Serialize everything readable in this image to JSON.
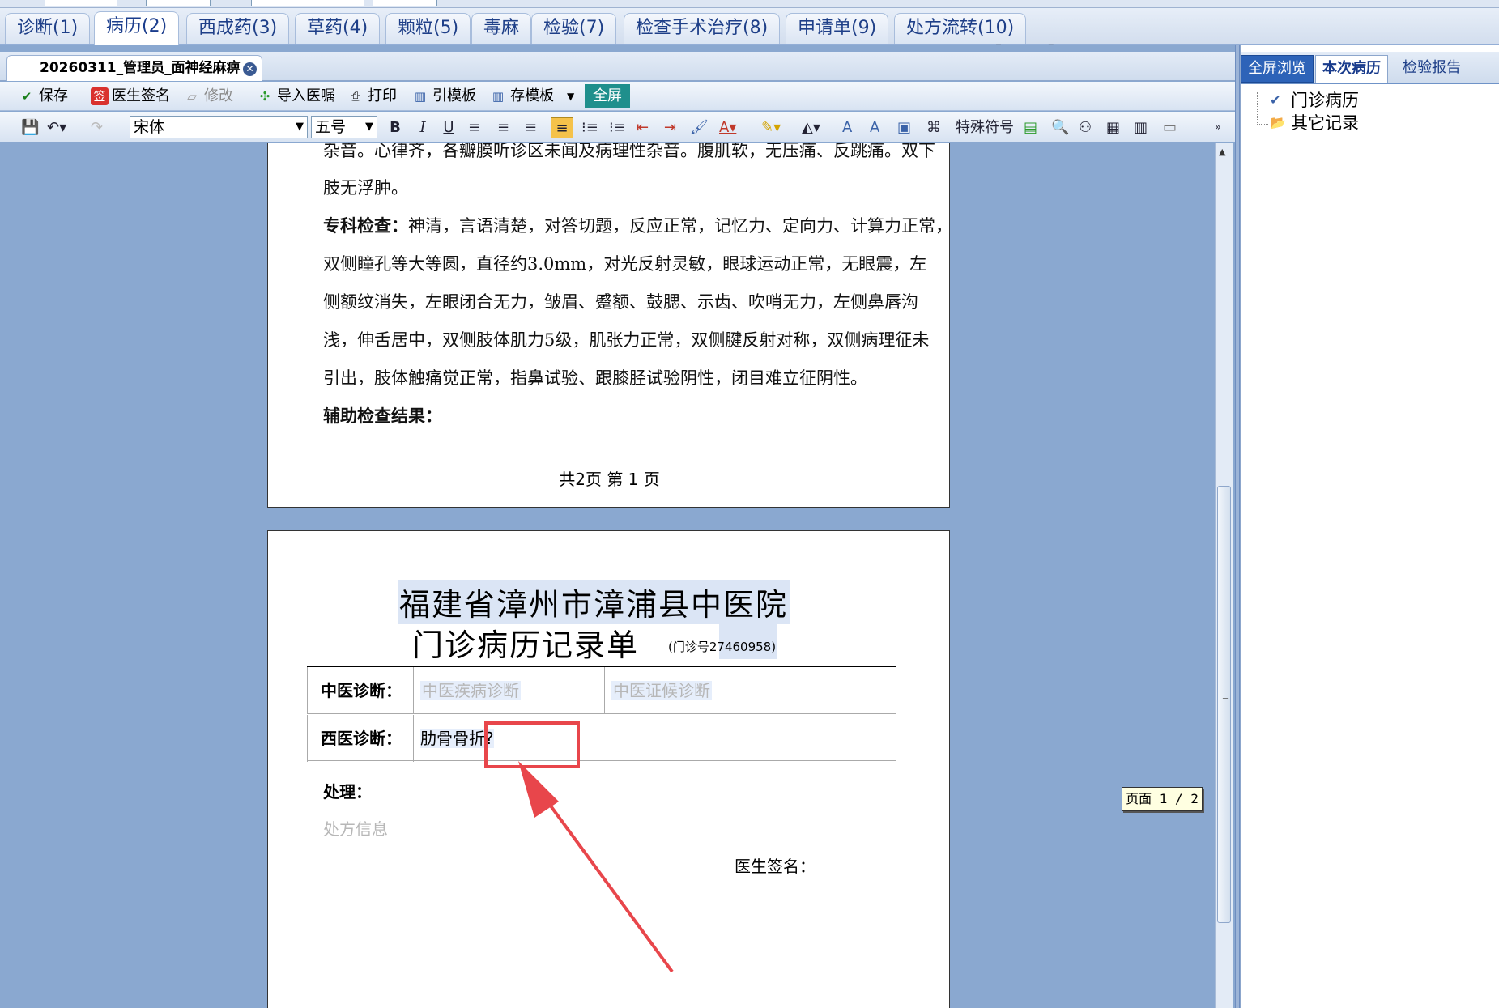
{
  "main_tabs": [
    {
      "label": "诊断(1)"
    },
    {
      "label": "病历(2)"
    },
    {
      "label": "西成药(3)"
    },
    {
      "label": "草药(4)"
    },
    {
      "label": "颗粒(5)"
    },
    {
      "label": "毒麻"
    },
    {
      "label": "检验(7)"
    },
    {
      "label": "检查手术治疗(8)"
    },
    {
      "label": "申请单(9)"
    },
    {
      "label": "处方流转(10)"
    }
  ],
  "document_tab": {
    "title": "20260311_管理员_面神经麻痹"
  },
  "toolbar1": {
    "save": "保存",
    "doctor_sign": "医生签名",
    "modify": "修改",
    "import_orders": "导入医嘱",
    "print": "打印",
    "use_template": "引模板",
    "save_template": "存模板",
    "fullscreen": "全屏"
  },
  "toolbar2": {
    "font_family": "宋体",
    "font_size": "五号",
    "bold": "B",
    "italic": "I",
    "underline": "U",
    "special_chars": "特殊符号"
  },
  "page1": {
    "line0": "杂音。心律齐，各瓣膜听诊区未闻及病理性杂音。腹肌软，无压痛、反跳痛。双下",
    "line1": "肢无浮肿。",
    "specialty_label": "专科检查：",
    "specialty_line1": "神清，言语清楚，对答切题，反应正常，记忆力、定向力、计算力正常，",
    "specialty_line2": "双侧瞳孔等大等圆，直径约3.0mm，对光反射灵敏，眼球运动正常，无眼震，左",
    "specialty_line3": "侧额纹消失，左眼闭合无力，皱眉、蹙额、鼓腮、示齿、吹哨无力，左侧鼻唇沟",
    "specialty_line4": "浅，伸舌居中，双侧肢体肌力5级，肌张力正常，双侧腱反射对称，双侧病理征未",
    "specialty_line5": "引出，肢体触痛觉正常，指鼻试验、跟膝胫试验阴性，闭目难立征阴性。",
    "aux_label": "辅助检查结果：",
    "footer": "共2页   第 1 页"
  },
  "page2": {
    "hospital_name": "福建省漳州市漳浦县中医院",
    "record_title": "门诊病历记录单",
    "visit_no": "(门诊号27460958)",
    "tcm_diag_label": "中医诊断：",
    "tcm_disease_placeholder": "中医疾病诊断",
    "tcm_syndrome_placeholder": "中医证候诊断",
    "western_diag_label": "西医诊断：",
    "western_diag_value": "肋骨骨折",
    "western_diag_mark": "?",
    "treatment_label": "处理：",
    "rx_placeholder": "处方信息",
    "doctor_sign_label": "医生签名："
  },
  "page_indicator": "页面 1 / 2",
  "right_panel": {
    "tabs": [
      {
        "label": "全屏浏览"
      },
      {
        "label": "本次病历"
      },
      {
        "label": "检验报告"
      }
    ],
    "tree": [
      {
        "label": "门诊病历"
      },
      {
        "label": "其它记录"
      }
    ]
  },
  "colors": {
    "canvas_bg": "#8aa8d0",
    "fullscreen_btn": "#1f8f8c",
    "highlight": "#e8464b"
  }
}
